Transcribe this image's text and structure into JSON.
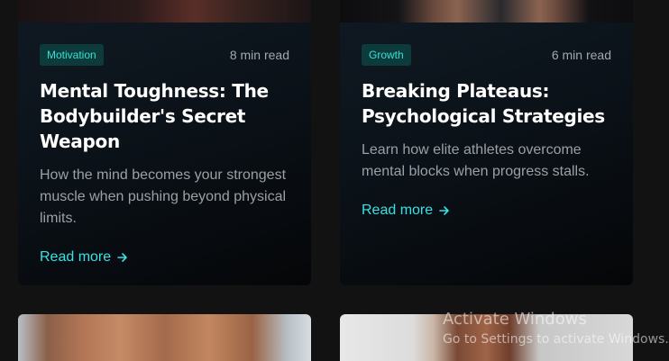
{
  "cards": [
    {
      "tag": "Motivation",
      "read_time": "8 min read",
      "title": "Mental Toughness: The Bodybuilder's Secret Weapon",
      "description": "How the mind becomes your strongest muscle when pushing beyond physical limits.",
      "link_label": "Read more"
    },
    {
      "tag": "Growth",
      "read_time": "6 min read",
      "title": "Breaking Plateaus: Psychological Strategies",
      "description": "Learn how elite athletes overcome mental blocks when progress stalls.",
      "link_label": "Read more"
    }
  ],
  "watermark": {
    "title": "Activate Windows",
    "subtitle": "Go to Settings to activate Windows."
  },
  "colors": {
    "accent": "#36e2e4",
    "tag_bg": "#0d3b3b",
    "page_bg": "#121212"
  },
  "icons": [
    "arrow-right-icon"
  ]
}
